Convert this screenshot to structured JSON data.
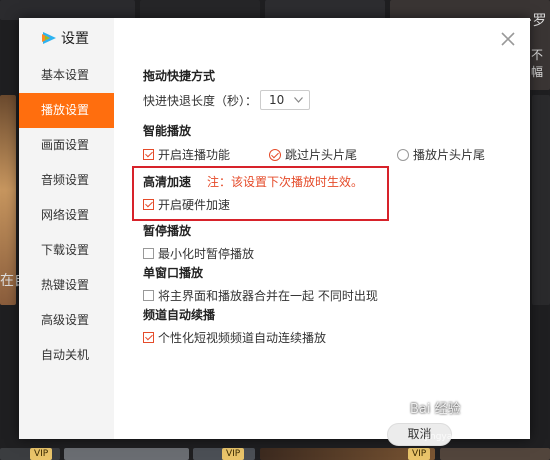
{
  "background": {
    "right_text_top": "·罗",
    "right_text_second": "不幅",
    "left_text": "在自",
    "vip_badge": "VIP"
  },
  "dialog": {
    "title": "设置",
    "logo_icon": "tencent-video-logo-icon",
    "close_icon": "close-icon"
  },
  "sidebar": {
    "items": [
      {
        "label": "基本设置",
        "active": false
      },
      {
        "label": "播放设置",
        "active": true
      },
      {
        "label": "画面设置",
        "active": false
      },
      {
        "label": "音频设置",
        "active": false
      },
      {
        "label": "网络设置",
        "active": false
      },
      {
        "label": "下载设置",
        "active": false
      },
      {
        "label": "热键设置",
        "active": false
      },
      {
        "label": "高级设置",
        "active": false
      },
      {
        "label": "自动关机",
        "active": false
      }
    ]
  },
  "settings": {
    "drag": {
      "heading": "拖动快捷方式",
      "label": "快进快退长度（秒）：",
      "value": "10"
    },
    "smart": {
      "heading": "智能播放",
      "continuous": {
        "label": "开启连播功能",
        "checked": true
      },
      "skip_intro": {
        "label": "跳过片头片尾",
        "checked": true
      },
      "play_intro": {
        "label": "播放片头片尾",
        "checked": false
      }
    },
    "hd": {
      "heading": "高清加速",
      "note": "注：该设置下次播放时生效。",
      "hardware": {
        "label": "开启硬件加速",
        "checked": true
      }
    },
    "pause": {
      "heading": "暂停播放",
      "minimize": {
        "label": "最小化时暂停播放",
        "checked": false
      }
    },
    "single": {
      "heading": "单窗口播放",
      "merge": {
        "label": "将主界面和播放器合并在一起 不同时出现",
        "checked": false
      }
    },
    "channel": {
      "heading": "频道自动续播",
      "personalized": {
        "label": "个性化短视频频道自动连续播放",
        "checked": true
      }
    }
  },
  "footer": {
    "cancel_label": "取消",
    "watermark": "Bai 经验",
    "watermark_url": "jingyan.baidu.com"
  },
  "colors": {
    "accent": "#ff6e0e",
    "check": "#e54b2a",
    "highlight_box": "#d7222a"
  }
}
